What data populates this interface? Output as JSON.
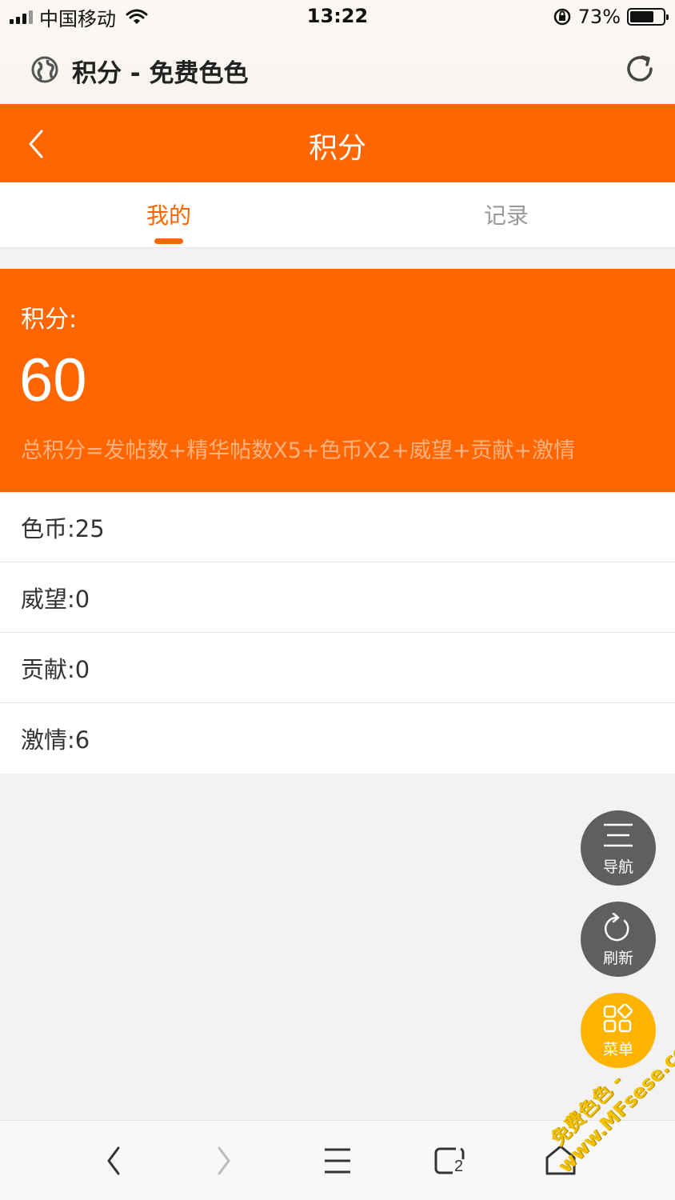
{
  "status_bar": {
    "carrier": "中国移动",
    "time": "13:22",
    "battery_percent": "73%",
    "battery_level": 0.73
  },
  "browser": {
    "page_title": "积分 - 免费色色",
    "icons": [
      "globe-icon",
      "reload-icon"
    ]
  },
  "header": {
    "title": "积分"
  },
  "tabs": [
    {
      "label": "我的",
      "active": true
    },
    {
      "label": "记录",
      "active": false
    }
  ],
  "score_card": {
    "label": "积分:",
    "value": "60",
    "formula": "总积分=发帖数+精华帖数X5+色币X2+威望+贡献+激情"
  },
  "stats": [
    {
      "label": "色币:25"
    },
    {
      "label": "威望:0"
    },
    {
      "label": "贡献:0"
    },
    {
      "label": "激情:6"
    }
  ],
  "floating_buttons": {
    "nav": "导航",
    "refresh": "刷新",
    "menu": "菜单"
  },
  "toolbar": {
    "tabs_count": "2",
    "icons": [
      "back-icon",
      "forward-icon",
      "menu-icon",
      "tabs-icon",
      "home-icon"
    ]
  },
  "watermark": {
    "line1": "免费色色 -",
    "line2": "www.MFsese.com"
  },
  "colors": {
    "accent": "#ff6600",
    "menu_button": "#ffb400",
    "fab_grey": "#5f5f5f"
  }
}
